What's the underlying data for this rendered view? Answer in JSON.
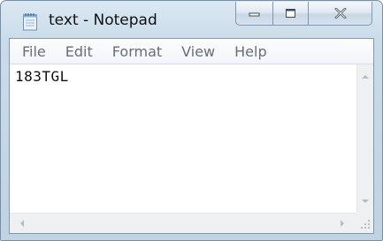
{
  "window": {
    "title": "text - Notepad",
    "app_icon": "notepad-icon"
  },
  "caption_buttons": {
    "minimize_icon": "minimize-icon",
    "maximize_icon": "maximize-icon",
    "close_icon": "close-icon"
  },
  "menu": {
    "items": [
      {
        "label": "File"
      },
      {
        "label": "Edit"
      },
      {
        "label": "Format"
      },
      {
        "label": "View"
      },
      {
        "label": "Help"
      }
    ]
  },
  "editor": {
    "content": "183TGL"
  },
  "colors": {
    "window_frame": "#c9dbe9",
    "close_button": "#d6e2ee",
    "menu_text": "#6a6f75",
    "editor_text": "#111111"
  }
}
